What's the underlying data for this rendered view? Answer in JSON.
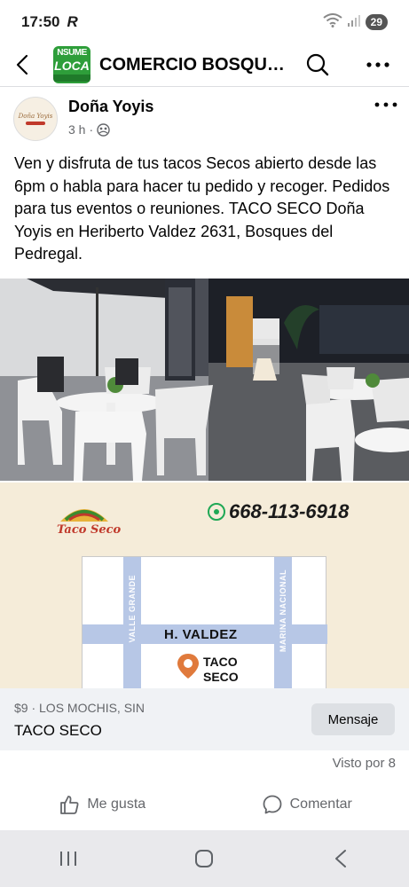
{
  "status_bar": {
    "time": "17:50",
    "carrier_glyph": "R",
    "battery": "29",
    "icons": [
      "wifi-icon",
      "signal-icon",
      "battery-icon"
    ]
  },
  "header": {
    "title": "COMMERCIO BOSQU…",
    "title_full": "COMERCIO BOSQU…",
    "logo_line1": "NSUME",
    "logo_line2": "LOCA",
    "icons": [
      "back-arrow-icon",
      "search-icon",
      "more-horizontal-icon"
    ]
  },
  "post": {
    "author": "Doña Yoyis",
    "time": "3 h",
    "separator": "·",
    "avatar_text": "Doña Yoyis",
    "text": "Ven y disfruta de tus tacos Secos abierto desde las 6pm o habla para hacer tu pedido y recoger. Pedidos para tus eventos o reuniones. TACO SECO Doña Yoyis en Heriberto Valdez 2631, Bosques del Pedregal."
  },
  "flyer": {
    "phone": "668-113-6918",
    "brand": "Taco Seco",
    "street_horizontal": "H. VALDEZ",
    "street_left": "VALLE GRANDE",
    "street_right": "MARINA NACIONAL",
    "pin_label_line1": "TACO",
    "pin_label_line2": "SECO"
  },
  "marketplace": {
    "price_location": "$9 · LOS MOCHIS, SIN",
    "title": "TACO SECO",
    "message_button": "Mensaje"
  },
  "views": "Visto por 8",
  "actions": {
    "like": "Me gusta",
    "comment": "Comentar"
  },
  "colors": {
    "group_logo": "#2e9e3a",
    "whatsapp": "#1fa855",
    "pin": "#e07a3c",
    "street": "#b7c7e6",
    "secondary_text": "#65676b"
  }
}
